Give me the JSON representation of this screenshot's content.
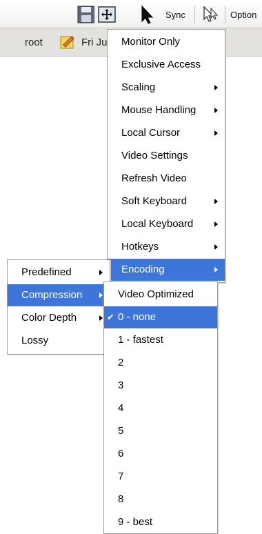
{
  "toolbar": {
    "sync_label": "Sync",
    "options_label": "Option",
    "icons": [
      "save-icon",
      "fit-window-icon",
      "pointer-icon",
      "single-cursor-icon"
    ]
  },
  "status": {
    "user": "root",
    "date_fragment": "Fri Ju",
    "icon": "note-icon"
  },
  "main_menu": {
    "items": [
      {
        "label": "Monitor Only",
        "submenu": false
      },
      {
        "label": "Exclusive Access",
        "submenu": false
      },
      {
        "label": "Scaling",
        "submenu": true
      },
      {
        "label": "Mouse Handling",
        "submenu": true
      },
      {
        "label": "Local Cursor",
        "submenu": true
      },
      {
        "label": "Video Settings",
        "submenu": false
      },
      {
        "label": "Refresh Video",
        "submenu": false
      },
      {
        "label": "Soft Keyboard",
        "submenu": true
      },
      {
        "label": "Local Keyboard",
        "submenu": true
      },
      {
        "label": "Hotkeys",
        "submenu": true
      },
      {
        "label": "Encoding",
        "submenu": true,
        "highlighted": true
      }
    ]
  },
  "encoding_menu": {
    "items": [
      {
        "label": "Predefined",
        "submenu": true
      },
      {
        "label": "Compression",
        "submenu": true,
        "highlighted": true
      },
      {
        "label": "Color Depth",
        "submenu": true
      },
      {
        "label": "Lossy",
        "submenu": false
      }
    ]
  },
  "compression_menu": {
    "items": [
      {
        "label": "Video Optimized"
      },
      {
        "label": "0 - none",
        "checked": true,
        "highlighted": true
      },
      {
        "label": "1 - fastest"
      },
      {
        "label": "2"
      },
      {
        "label": "3"
      },
      {
        "label": "4"
      },
      {
        "label": "5"
      },
      {
        "label": "6"
      },
      {
        "label": "7"
      },
      {
        "label": "8"
      },
      {
        "label": "9 - best"
      }
    ]
  },
  "colors": {
    "highlight": "#3d76d8",
    "menu_border": "#9a9a9a",
    "statusbar": "#e4e2de"
  }
}
